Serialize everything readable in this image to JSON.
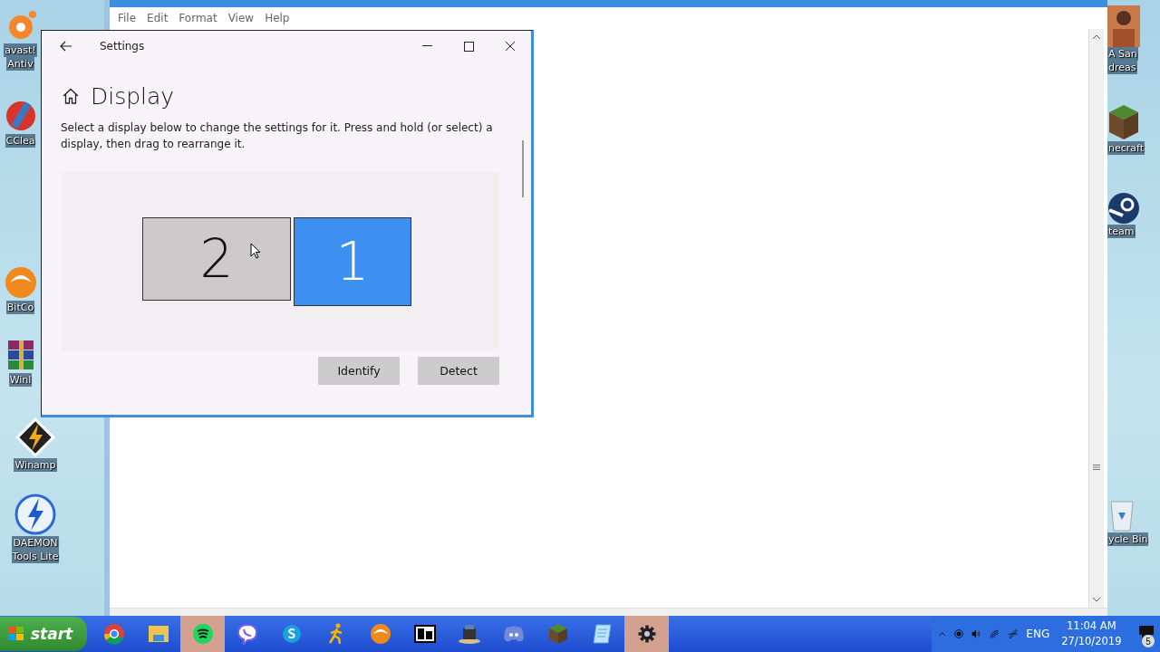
{
  "desktop_left": [
    {
      "kind": "avast",
      "lines": [
        "avast!",
        "Antiv"
      ]
    },
    {
      "kind": "ccleaner",
      "lines": [
        "CClea"
      ]
    },
    {
      "kind": "bitcomet",
      "lines": [
        "BitCo"
      ]
    },
    {
      "kind": "winrar",
      "lines": [
        "Winl"
      ]
    },
    {
      "kind": "winamp",
      "lines": [
        "Winamp"
      ]
    },
    {
      "kind": "daemon",
      "lines": [
        "DAEMON",
        "Tools Lite"
      ]
    }
  ],
  "desktop_right": [
    {
      "kind": "gta",
      "lines": [
        "A San",
        "dreas"
      ]
    },
    {
      "kind": "minecraft",
      "lines": [
        "necraft"
      ]
    },
    {
      "kind": "steam",
      "lines": [
        "team"
      ]
    },
    {
      "kind": "recycle",
      "lines": [
        "ycle Bin"
      ]
    }
  ],
  "notepad": {
    "menu": [
      "File",
      "Edit",
      "Format",
      "View",
      "Help"
    ]
  },
  "settings": {
    "title": "Settings",
    "heading": "Display",
    "description": "Select a display below to change the settings for it. Press and hold (or select) a display, then drag to rearrange it.",
    "displays": [
      {
        "label": "2",
        "selected": false
      },
      {
        "label": "1",
        "selected": true
      }
    ],
    "buttons": [
      "Identify",
      "Detect"
    ]
  },
  "taskbar": {
    "start": "start",
    "apps": [
      {
        "kind": "chrome",
        "selected": false
      },
      {
        "kind": "folder",
        "selected": false
      },
      {
        "kind": "spotify",
        "selected": true
      },
      {
        "kind": "viber",
        "selected": false
      },
      {
        "kind": "skype",
        "selected": false
      },
      {
        "kind": "runner",
        "selected": false
      },
      {
        "kind": "bitcomet",
        "selected": false
      },
      {
        "kind": "sevenzip",
        "selected": false
      },
      {
        "kind": "desk",
        "selected": false
      },
      {
        "kind": "discord",
        "selected": false
      },
      {
        "kind": "minecraft",
        "selected": false
      },
      {
        "kind": "notepad",
        "selected": false
      },
      {
        "kind": "settings",
        "selected": true
      }
    ],
    "language": "ENG",
    "time": "11:04 AM",
    "date": "27/10/2019",
    "notifications": "5"
  }
}
